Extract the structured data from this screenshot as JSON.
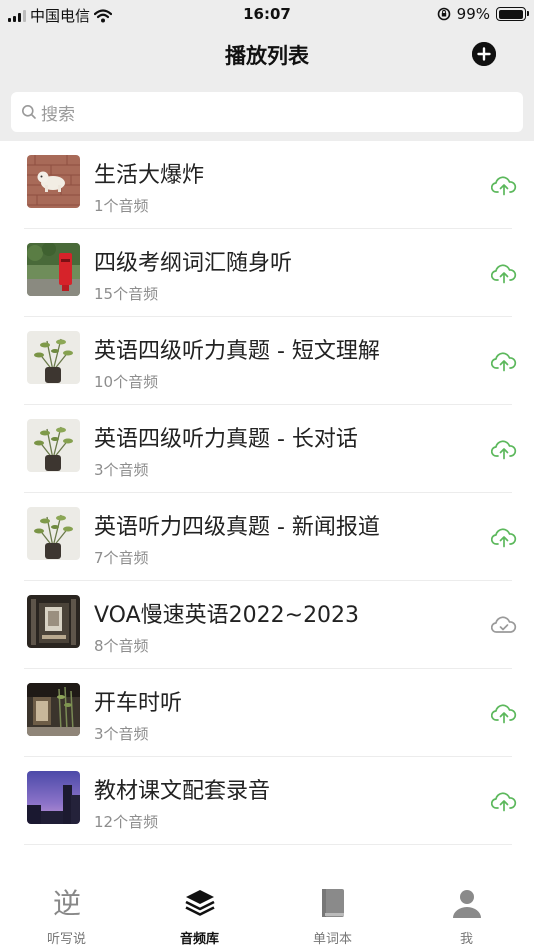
{
  "status": {
    "carrier": "中国电信",
    "time": "16:07",
    "battery": "99%"
  },
  "header": {
    "title": "播放列表",
    "add_icon": "plus-circle-icon"
  },
  "search": {
    "placeholder": "搜索"
  },
  "playlists": [
    {
      "name": "生活大爆炸",
      "count": "1个音频",
      "sync": "upload"
    },
    {
      "name": "四级考纲词汇随身听",
      "count": "15个音频",
      "sync": "upload"
    },
    {
      "name": "英语四级听力真题 - 短文理解",
      "count": "10个音频",
      "sync": "upload"
    },
    {
      "name": "英语四级听力真题 - 长对话",
      "count": "3个音频",
      "sync": "upload"
    },
    {
      "name": "英语听力四级真题 - 新闻报道",
      "count": "7个音频",
      "sync": "upload"
    },
    {
      "name": "VOA慢速英语2022~2023",
      "count": "8个音频",
      "sync": "synced"
    },
    {
      "name": "开车时听",
      "count": "3个音频",
      "sync": "upload"
    },
    {
      "name": "教材课文配套录音",
      "count": "12个音频",
      "sync": "upload"
    }
  ],
  "tabs": [
    {
      "label": "听写说",
      "icon": "ni-character-icon"
    },
    {
      "label": "音频库",
      "icon": "layers-icon",
      "active": true
    },
    {
      "label": "单词本",
      "icon": "book-icon"
    },
    {
      "label": "我",
      "icon": "person-icon"
    }
  ],
  "colors": {
    "accent_green": "#5cb85c",
    "synced_gray": "#9a9a9a"
  }
}
